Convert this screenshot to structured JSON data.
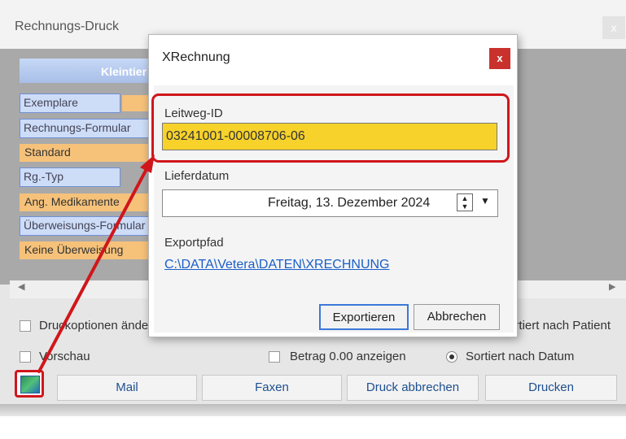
{
  "background_window": {
    "title": "Rechnungs-Druck",
    "close_label": "x",
    "header_label": "Kleintier",
    "fields": [
      {
        "label": "Exemplare",
        "kind": "blue"
      },
      {
        "label": "Rechnungs-Formular",
        "kind": "blue"
      },
      {
        "label": "Standard",
        "kind": "orange"
      },
      {
        "label": "Rg.-Typ",
        "kind": "blue"
      },
      {
        "label": "Ang. Medikamente",
        "kind": "orange"
      },
      {
        "label": "Überweisungs-Formular",
        "kind": "blue"
      },
      {
        "label": "Keine Überweisung",
        "kind": "orange"
      }
    ],
    "scroll_left": "◀",
    "scroll_right": "▶",
    "options": {
      "druckoptionen": "Druckoptionen ändern",
      "vorschau": "Vorschau",
      "betrag": "Betrag 0.00 anzeigen",
      "sort_patient": "Sortiert nach Patient",
      "sort_datum": "Sortiert nach Datum"
    },
    "buttons": {
      "mail": "Mail",
      "faxen": "Faxen",
      "druck_abbrechen": "Druck abbrechen",
      "drucken": "Drucken"
    }
  },
  "dialog": {
    "title": "XRechnung",
    "close_label": "x",
    "leitweg_label": "Leitweg-ID",
    "leitweg_value": "03241001-00008706-06",
    "lieferdatum_label": "Lieferdatum",
    "lieferdatum_value": "Freitag, 13. Dezember 2024",
    "exportpfad_label": "Exportpfad",
    "exportpfad_value": "C:\\DATA\\Vetera\\DATEN\\XRECHNUNG",
    "export_button": "Exportieren",
    "cancel_button": "Abbrechen"
  },
  "colors": {
    "highlight_red": "#d0161b",
    "leitweg_field_bg": "#f6d22a",
    "link_blue": "#1a5fc8"
  },
  "icons": {
    "dropdown": "chevron-down-icon",
    "spinner": "spin-updown-icon",
    "app_icon": "xrechnung-icon"
  }
}
